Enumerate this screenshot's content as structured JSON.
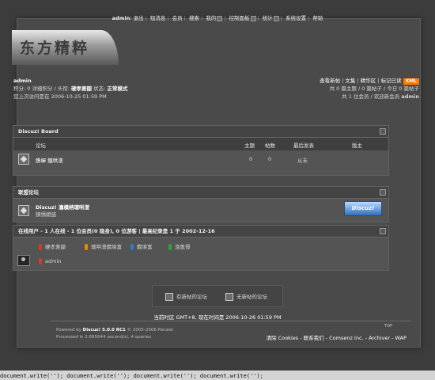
{
  "topnav": {
    "username": "admin",
    "items": [
      "退出",
      "短消息",
      "会员",
      "搜索",
      "我的",
      "控制面板",
      "统计",
      "系统设置",
      "帮助"
    ]
  },
  "logo": {
    "text": "东方精粹"
  },
  "userinfo": {
    "name": "admin",
    "line2_prefix": "积分: 0 详细积分 / 头衔: ",
    "title": "硬孝差額",
    "line2_status_label": " 状态: ",
    "status": "正常模式",
    "last_visit": "您上次访问是在 2006-10-25 01:59 PM"
  },
  "quicklinks": {
    "links": [
      "查看新帖",
      "文集",
      "精华区",
      "标记已读"
    ],
    "xml": "XML",
    "stats_line": "共 0 篇主题 / 0 篇帖子 / 今日 0 篇帖子",
    "members_prefix": "共 1 位会员 / 欢迎新会员 ",
    "new_member": "admin"
  },
  "board": {
    "title": "Discuz! Board",
    "columns": {
      "forum": "论坛",
      "topics": "主题",
      "posts": "帖数",
      "last": "最后发表",
      "mod": "版主"
    },
    "forum": {
      "name": "鎸樿  鐵哄潧",
      "topics": "0",
      "posts": "0",
      "last": "从未"
    }
  },
  "league": {
    "title": "联盟论坛",
    "name": "Discuz! 瀹樻柟璁哄潧",
    "desc": "鎻愪緵鐩",
    "badge": "Discuz!"
  },
  "online": {
    "title_prefix": "在线用户 - ",
    "title_count": "1",
    "title_mid": " 人在线 - ",
    "title_members": "1",
    "title_mid2": " 位会员(",
    "title_hidden": "0",
    "title_mid3": " 隐身), ",
    "title_guests": "0",
    "title_mid4": " 位游客 | 最高纪录是 ",
    "title_record": "1",
    "title_mid5": " 于 ",
    "title_date": "2002-12-16",
    "legend": [
      {
        "label": "硬孝差額",
        "color": "#d23b2a"
      },
      {
        "label": "璁哄潧鐗堜富",
        "color": "#e68a00"
      },
      {
        "label": "鐗堜富",
        "color": "#2f7bd1"
      },
      {
        "label": "浼氬憳",
        "color": "#2fa52f"
      }
    ],
    "user": {
      "label": "admin",
      "color": "#d23b2a"
    }
  },
  "icon_legend": {
    "new": "有新帖的论坛",
    "nonew": "无新帖的论坛"
  },
  "timezone": "当前时区 GMT+8, 现在时间是 2006-10-26 01:59 PM",
  "top_link": "TOP",
  "footer": {
    "powered_prefix": "Powered by ",
    "powered_name": "Discuz! 5.0.0 RC1",
    "powered_suffix": " © 2005-2006 Panwei",
    "processed": "Processed in 2.695644 second(s), 4 queries",
    "links": "清除 Cookies - 联系我们 - Comsenz Inc. - Archiver - WAP"
  },
  "statusbar": "document.write(''); document.write(''); document.write(''); document.write('');"
}
